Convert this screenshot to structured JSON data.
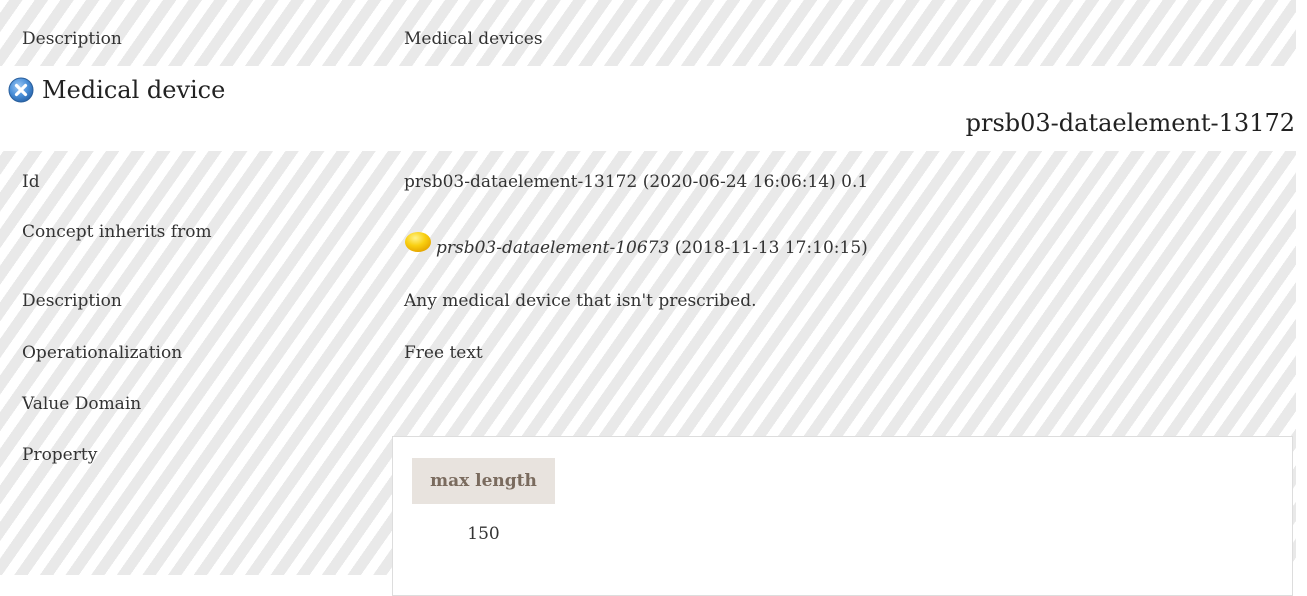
{
  "top": {
    "description_label": "Description",
    "description_value": "Medical devices"
  },
  "heading": {
    "icon": "blue-x-circle-icon",
    "title": "Medical device"
  },
  "concept_id": "prsb03-dataelement-13172",
  "details": {
    "id_label": "Id",
    "id_value": "prsb03-dataelement-13172 (2020-06-24 16:06:14) 0.1",
    "inherits_label": "Concept inherits from",
    "inherits_icon": "yellow-circle-icon",
    "inherits_id": "prsb03-dataelement-10673",
    "inherits_date": "(2018-11-13 17:10:15)",
    "description_label": "Description",
    "description_value": "Any medical device that isn't prescribed.",
    "operationalization_label": "Operationalization",
    "operationalization_value": "Free text",
    "value_domain_label": "Value Domain",
    "property_label": "Property",
    "property": {
      "header": "max length",
      "value": "150"
    }
  },
  "colors": {
    "stripe_light": "#ffffff",
    "stripe_dark": "#e9e9e9",
    "property_header_bg": "#e8e3de",
    "property_header_text": "#7a6b5e",
    "icon_blue": "#4a8fd8",
    "icon_yellow": "#f5c400"
  }
}
